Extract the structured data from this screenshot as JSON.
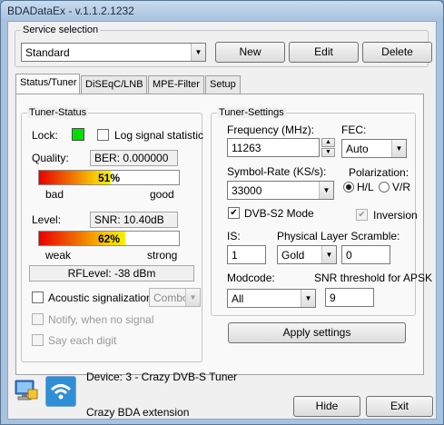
{
  "window": {
    "title": "BDADataEx - v.1.1.2.1232"
  },
  "service": {
    "legend": "Service selection",
    "selected": "Standard",
    "new_label": "New",
    "edit_label": "Edit",
    "delete_label": "Delete"
  },
  "tabs": [
    {
      "label": "Status/Tuner",
      "active": true
    },
    {
      "label": "DiSEqC/LNB",
      "active": false
    },
    {
      "label": "MPE-Filter",
      "active": false
    },
    {
      "label": "Setup",
      "active": false
    }
  ],
  "tuner_status": {
    "legend": "Tuner-Status",
    "lock_label": "Lock:",
    "lock_color": "#00e000",
    "log_label": "Log signal statistic",
    "log_checked": false,
    "quality_label": "Quality:",
    "ber_text": "BER: 0.000000",
    "quality_percent": 51,
    "quality_percent_text": "51%",
    "quality_bad": "bad",
    "quality_good": "good",
    "level_label": "Level:",
    "snr_text": "SNR: 10.40dB",
    "level_percent": 62,
    "level_percent_text": "62%",
    "level_weak": "weak",
    "level_strong": "strong",
    "rflevel_text": "RFLevel: -38 dBm",
    "acoustic_label": "Acoustic signalization:",
    "acoustic_checked": false,
    "acoustic_mode": "Combo",
    "notify_label": "Notify, when no signal",
    "say_digit_label": "Say each digit"
  },
  "tuner_settings": {
    "legend": "Tuner-Settings",
    "frequency_label": "Frequency (MHz):",
    "frequency_value": "11263",
    "fec_label": "FEC:",
    "fec_value": "Auto",
    "symbolrate_label": "Symbol-Rate (KS/s):",
    "symbolrate_value": "33000",
    "polarization_label": "Polarization:",
    "pol_hl_label": "H/L",
    "pol_vr_label": "V/R",
    "pol_selected": "H/L",
    "dvbs2_label": "DVB-S2 Mode",
    "dvbs2_checked": true,
    "inversion_label": "Inversion",
    "inversion_checked": true,
    "is_label": "IS:",
    "is_value": "1",
    "pls_label": "Physical Layer Scramble:",
    "pls_mode": "Gold",
    "pls_value": "0",
    "modcode_label": "Modcode:",
    "modcode_value": "All",
    "snr_threshold_label": "SNR threshold for APSK",
    "snr_threshold_value": "9"
  },
  "apply_label": "Apply settings",
  "footer": {
    "device_text": "Device: 3 - Crazy DVB-S Tuner",
    "extension_text": "Crazy BDA extension",
    "hide_label": "Hide",
    "exit_label": "Exit",
    "icon1": "computer-monitor-icon",
    "icon2": "wireless-signal-icon"
  }
}
